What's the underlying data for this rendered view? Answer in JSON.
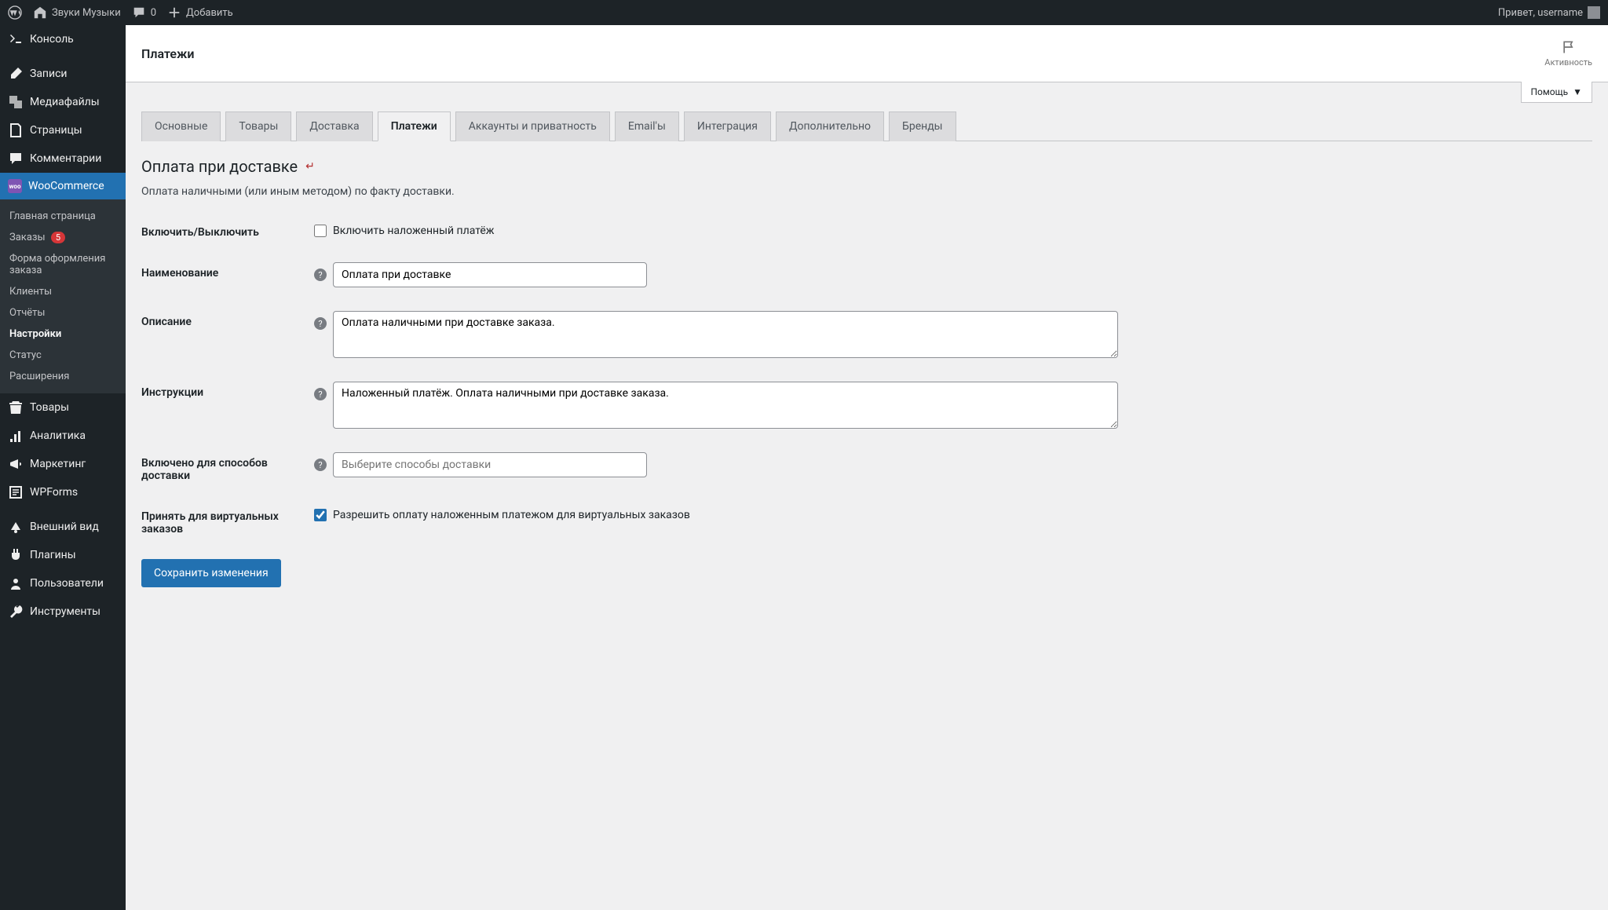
{
  "adminbar": {
    "site_name": "Звуки Музыки",
    "comments_count": "0",
    "add_new": "Добавить",
    "greeting": "Привет, username"
  },
  "sidebar": {
    "console": "Консоль",
    "posts": "Записи",
    "media": "Медиафайлы",
    "pages": "Страницы",
    "comments": "Комментарии",
    "woocommerce": "WooCommerce",
    "woo_submenu": {
      "home": "Главная страница",
      "orders": "Заказы",
      "orders_badge": "5",
      "checkout_form": "Форма оформления заказа",
      "customers": "Клиенты",
      "reports": "Отчёты",
      "settings": "Настройки",
      "status": "Статус",
      "extensions": "Расширения"
    },
    "products": "Товары",
    "analytics": "Аналитика",
    "marketing": "Маркетинг",
    "wpforms": "WPForms",
    "appearance": "Внешний вид",
    "plugins": "Плагины",
    "users": "Пользователи",
    "tools": "Инструменты"
  },
  "header": {
    "title": "Платежи",
    "activity": "Активность",
    "help": "Помощь"
  },
  "tabs": {
    "general": "Основные",
    "products": "Товары",
    "shipping": "Доставка",
    "payments": "Платежи",
    "accounts": "Аккаунты и приватность",
    "emails": "Email'ы",
    "integration": "Интеграция",
    "advanced": "Дополнительно",
    "brands": "Бренды"
  },
  "section": {
    "title": "Оплата при доставке",
    "back_symbol": "↵",
    "description": "Оплата наличными (или иным методом) по факту доставки."
  },
  "form": {
    "enable_label": "Включить/Выключить",
    "enable_checkbox": "Включить наложенный платёж",
    "enable_checked": false,
    "title_label": "Наименование",
    "title_value": "Оплата при доставке",
    "desc_label": "Описание",
    "desc_value": "Оплата наличными при доставке заказа.",
    "instructions_label": "Инструкции",
    "instructions_value": "Наложенный платёж. Оплата наличными при доставке заказа.",
    "shipping_label": "Включено для способов доставки",
    "shipping_placeholder": "Выберите способы доставки",
    "virtual_label": "Принять для виртуальных заказов",
    "virtual_checkbox": "Разрешить оплату наложенным платежом для виртуальных заказов",
    "virtual_checked": true,
    "save_button": "Сохранить изменения"
  }
}
